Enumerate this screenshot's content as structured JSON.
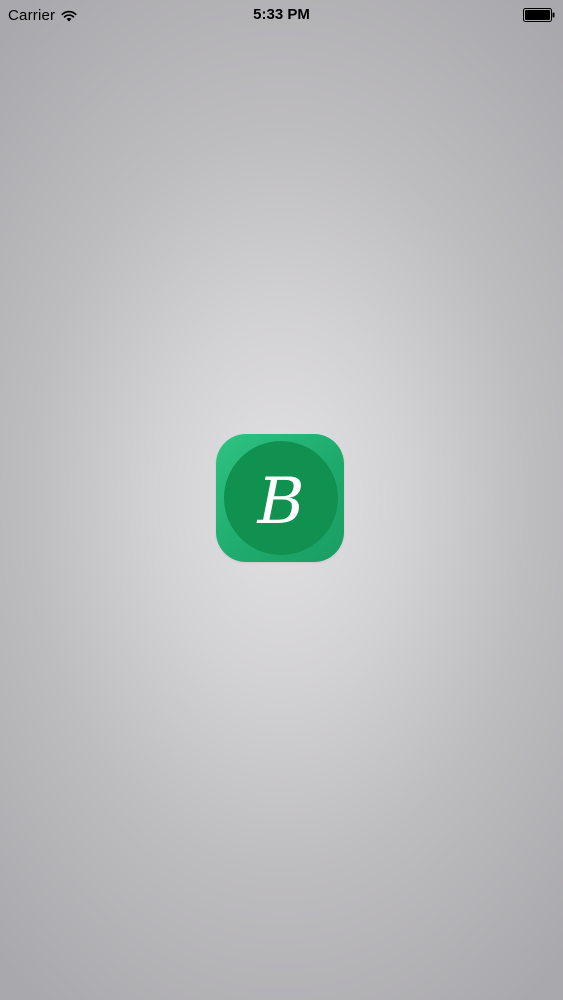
{
  "status_bar": {
    "carrier": "Carrier",
    "time": "5:33 PM",
    "wifi_icon": "wifi-icon",
    "battery_icon": "battery-full-icon"
  },
  "splash": {
    "logo_letter": "B",
    "logo_icon": "app-logo-icon",
    "colors": {
      "tile": "#25b676",
      "circle": "#11914f",
      "letter": "#ffffff"
    }
  }
}
